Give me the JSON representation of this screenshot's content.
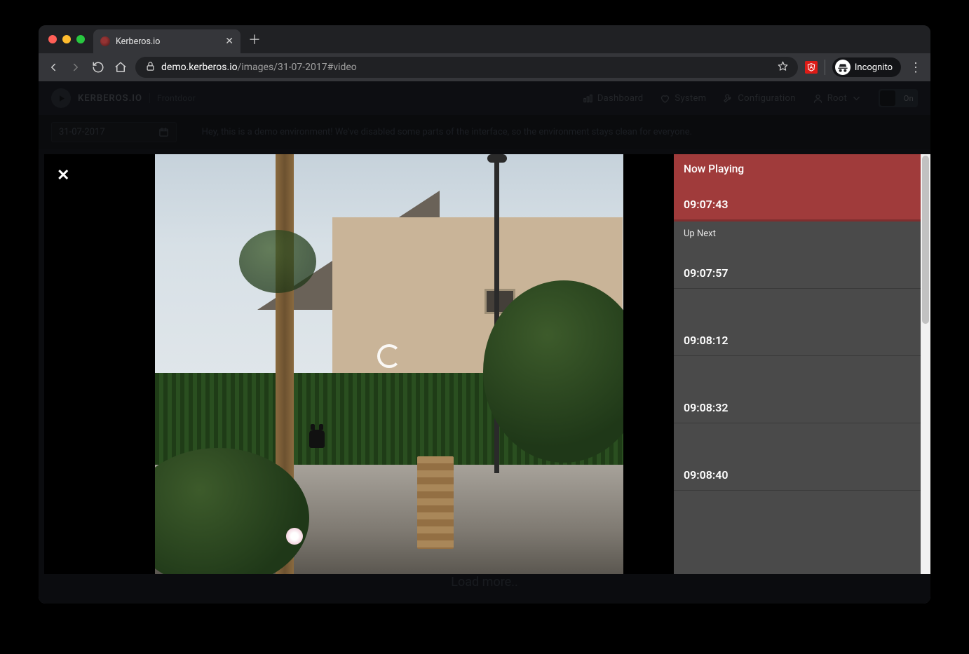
{
  "browser": {
    "tab_title": "Kerberos.io",
    "url_host": "demo.kerberos.io",
    "url_path": "/images/31-07-2017#video",
    "incognito_label": "Incognito"
  },
  "app": {
    "brand_name": "KERBEROS.IO",
    "brand_tag": "Frontdoor",
    "nav": {
      "dashboard": "Dashboard",
      "system": "System",
      "configuration": "Configuration",
      "user": "Root",
      "toggle_label": "On"
    },
    "date_value": "31-07-2017",
    "banner": "Hey, this is a demo environment! We've disabled some parts of the interface, so the environment stays clean for everyone.",
    "load_more": "Load more.."
  },
  "modal": {
    "now_playing_label": "Now Playing",
    "up_next_label": "Up Next",
    "playlist": [
      {
        "time": "09:07:43",
        "now": true
      },
      {
        "time": "09:07:57",
        "now": false,
        "upnext": true
      },
      {
        "time": "09:08:12",
        "now": false
      },
      {
        "time": "09:08:32",
        "now": false
      },
      {
        "time": "09:08:40",
        "now": false
      }
    ]
  }
}
